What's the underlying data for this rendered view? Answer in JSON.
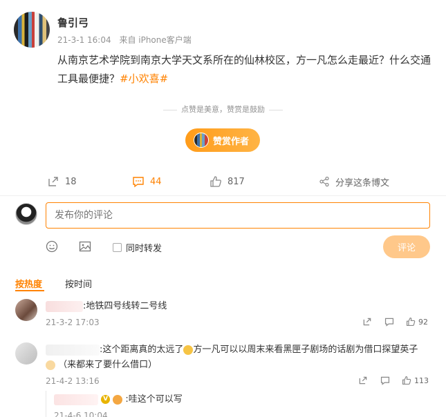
{
  "post": {
    "author": "鲁引弓",
    "time": "21-3-1 16:04",
    "source": "来自 iPhone客户端",
    "text": "从南京艺术学院到南京大学天文系所在的仙林校区，方一凡怎么走最近？什么交通工具最便捷？",
    "tag": "#小欢喜#"
  },
  "reward": {
    "tagline": "点赞是美意，赞赏是鼓励",
    "button_label": "赞赏作者"
  },
  "actions": {
    "repost_count": "18",
    "comment_count": "44",
    "like_count": "817",
    "share_label": "分享这条博文"
  },
  "composer": {
    "placeholder": "发布你的评论",
    "repost_label": "同时转发",
    "submit_label": "评论"
  },
  "sort": {
    "hot_label": "按热度",
    "time_label": "按时间"
  },
  "comments": [
    {
      "text": ":地铁四号线转二号线",
      "time": "21-3-2 17:03",
      "likes": "92"
    },
    {
      "text_a": ":这个距离真的太远了",
      "text_b": "方一凡可以以周末来看黑匣子剧场的话剧为借口探望英子",
      "text_c": "（来都来了要什么借口）",
      "time": "21-4-2 13:16",
      "likes": "113"
    }
  ],
  "reply": {
    "text": ":哇这个可以写",
    "time": "21-4-6 10:04"
  },
  "colors": {
    "accent": "#ff8200"
  }
}
